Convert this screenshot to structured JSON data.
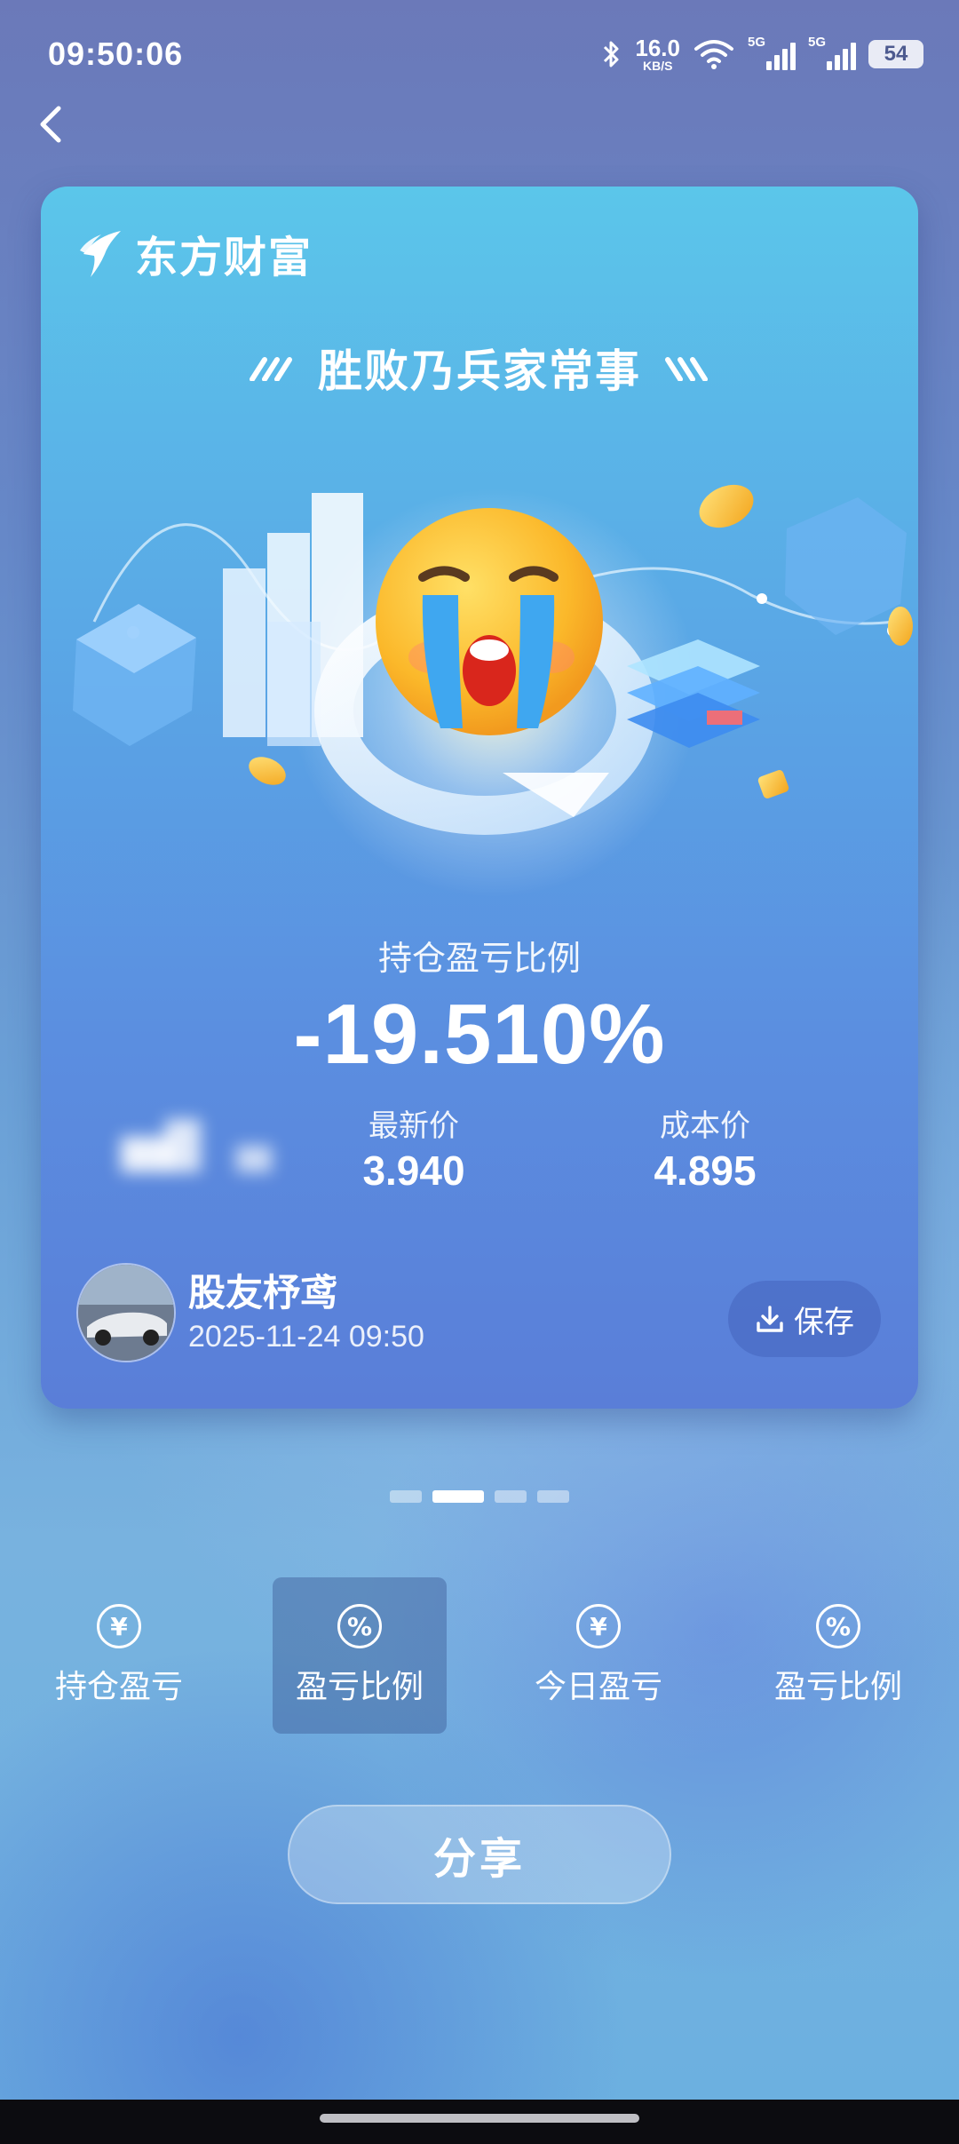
{
  "status_bar": {
    "time": "09:50:06",
    "net_speed_value": "16.0",
    "net_speed_unit": "KB/S",
    "signal_1_tag": "5G",
    "signal_2_tag": "5G",
    "battery": "54"
  },
  "card": {
    "brand_name": "东方财富",
    "slogan": "胜败乃兵家常事",
    "ratio_label": "持仓盈亏比例",
    "ratio_value": "-19.510%",
    "latest_price_label": "最新价",
    "latest_price": "3.940",
    "cost_price_label": "成本价",
    "cost_price": "4.895",
    "user_name": "股友杼鸢",
    "timestamp": "2025-11-24 09:50",
    "save_label": "保存",
    "accent_color": "#5aa9e6"
  },
  "pager": {
    "count": 4,
    "active_index": 1
  },
  "templates": [
    {
      "label": "持仓盈亏",
      "icon": "yen-icon",
      "glyph": "¥",
      "selected": false
    },
    {
      "label": "盈亏比例",
      "icon": "percent-icon",
      "glyph": "%",
      "selected": true
    },
    {
      "label": "今日盈亏",
      "icon": "yen-icon",
      "glyph": "¥",
      "selected": false
    },
    {
      "label": "盈亏比例",
      "icon": "percent-icon",
      "glyph": "%",
      "selected": false
    }
  ],
  "share_label": "分享"
}
